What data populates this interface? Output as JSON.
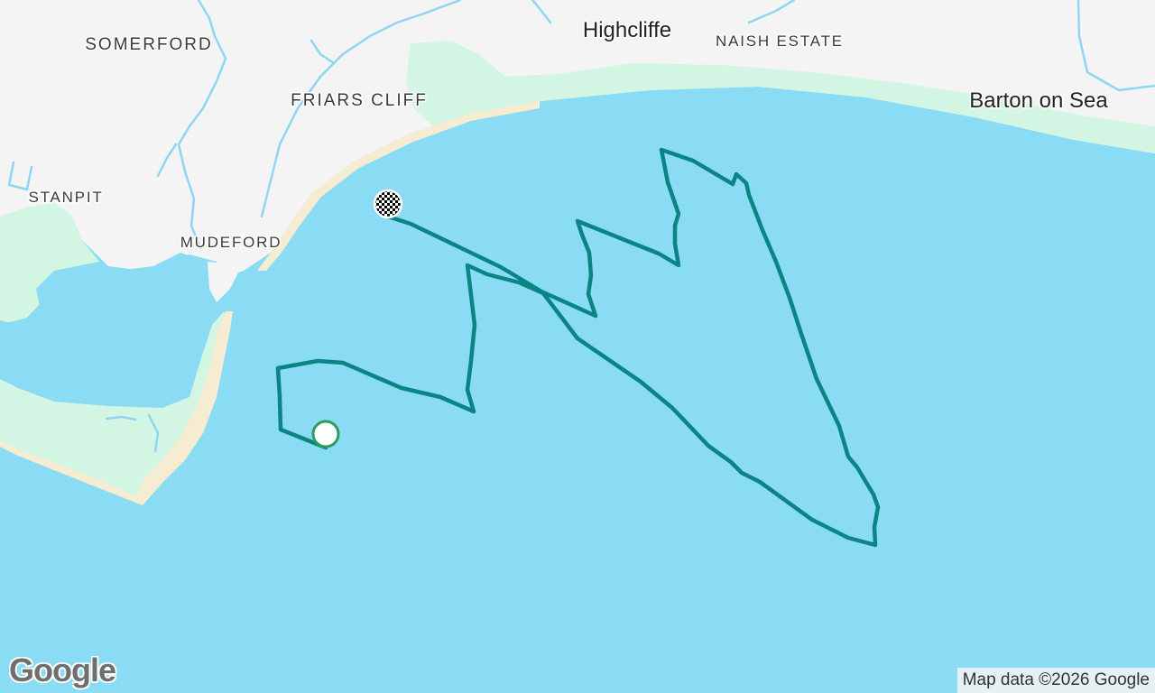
{
  "map": {
    "places": {
      "somerford": "SOMERFORD",
      "friars_cliff": "FRIARS CLIFF",
      "highcliffe": "Highcliffe",
      "naish_estate": "NAISH ESTATE",
      "barton_on_sea": "Barton on Sea",
      "stanpit": "STANPIT",
      "mudeford": "MUDEFORD"
    },
    "colors": {
      "water": "#8adbf4",
      "land": "#f4f4f4",
      "park": "#d3f5e3",
      "beach": "#f6ecd2",
      "river": "#8fd6f2",
      "route": "#0a8484",
      "start_fill": "#ffffff",
      "start_ring": "#2e9e5e"
    },
    "markers": {
      "start": "start-marker",
      "finish": "finish-flag"
    }
  },
  "branding": {
    "logo": "Google",
    "attribution": "Map data ©2026 Google"
  }
}
